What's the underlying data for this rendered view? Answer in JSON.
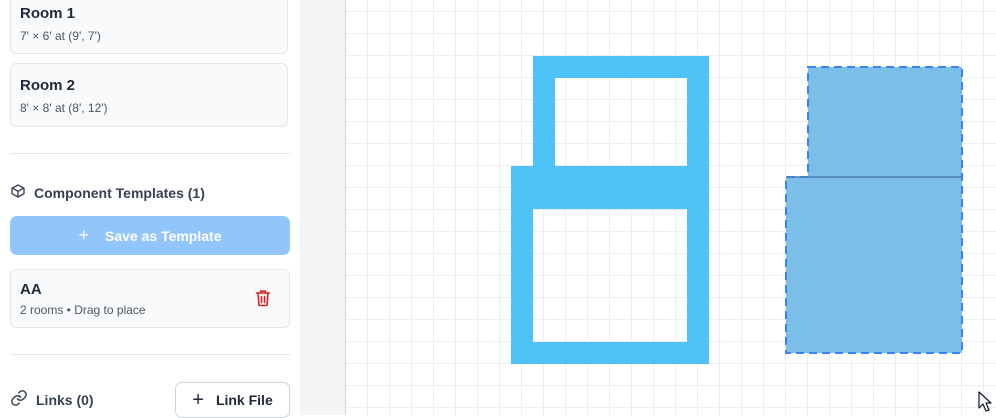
{
  "rooms": [
    {
      "name": "Room 1",
      "dims": "7' × 6' at (9', 7')"
    },
    {
      "name": "Room 2",
      "dims": "8' × 8' at (8', 12')"
    }
  ],
  "templates_section": {
    "title": "Component Templates (1)",
    "icon": "cube-icon",
    "save_button": {
      "plus": "+",
      "label": "Save as Template"
    },
    "items": [
      {
        "name": "AA",
        "meta": "2 rooms • Drag to place",
        "delete_icon": "trash-icon"
      }
    ]
  },
  "links_section": {
    "title": "Links (0)",
    "icon": "link-icon",
    "link_button": {
      "plus": "+",
      "label": "Link File"
    }
  },
  "colors": {
    "room_outline": "#4fc3f7",
    "selected_fill": "#7bbfe8",
    "selected_border": "#3b82f6",
    "delete": "#dc2626",
    "save_button_bg": "#93c5fd"
  }
}
